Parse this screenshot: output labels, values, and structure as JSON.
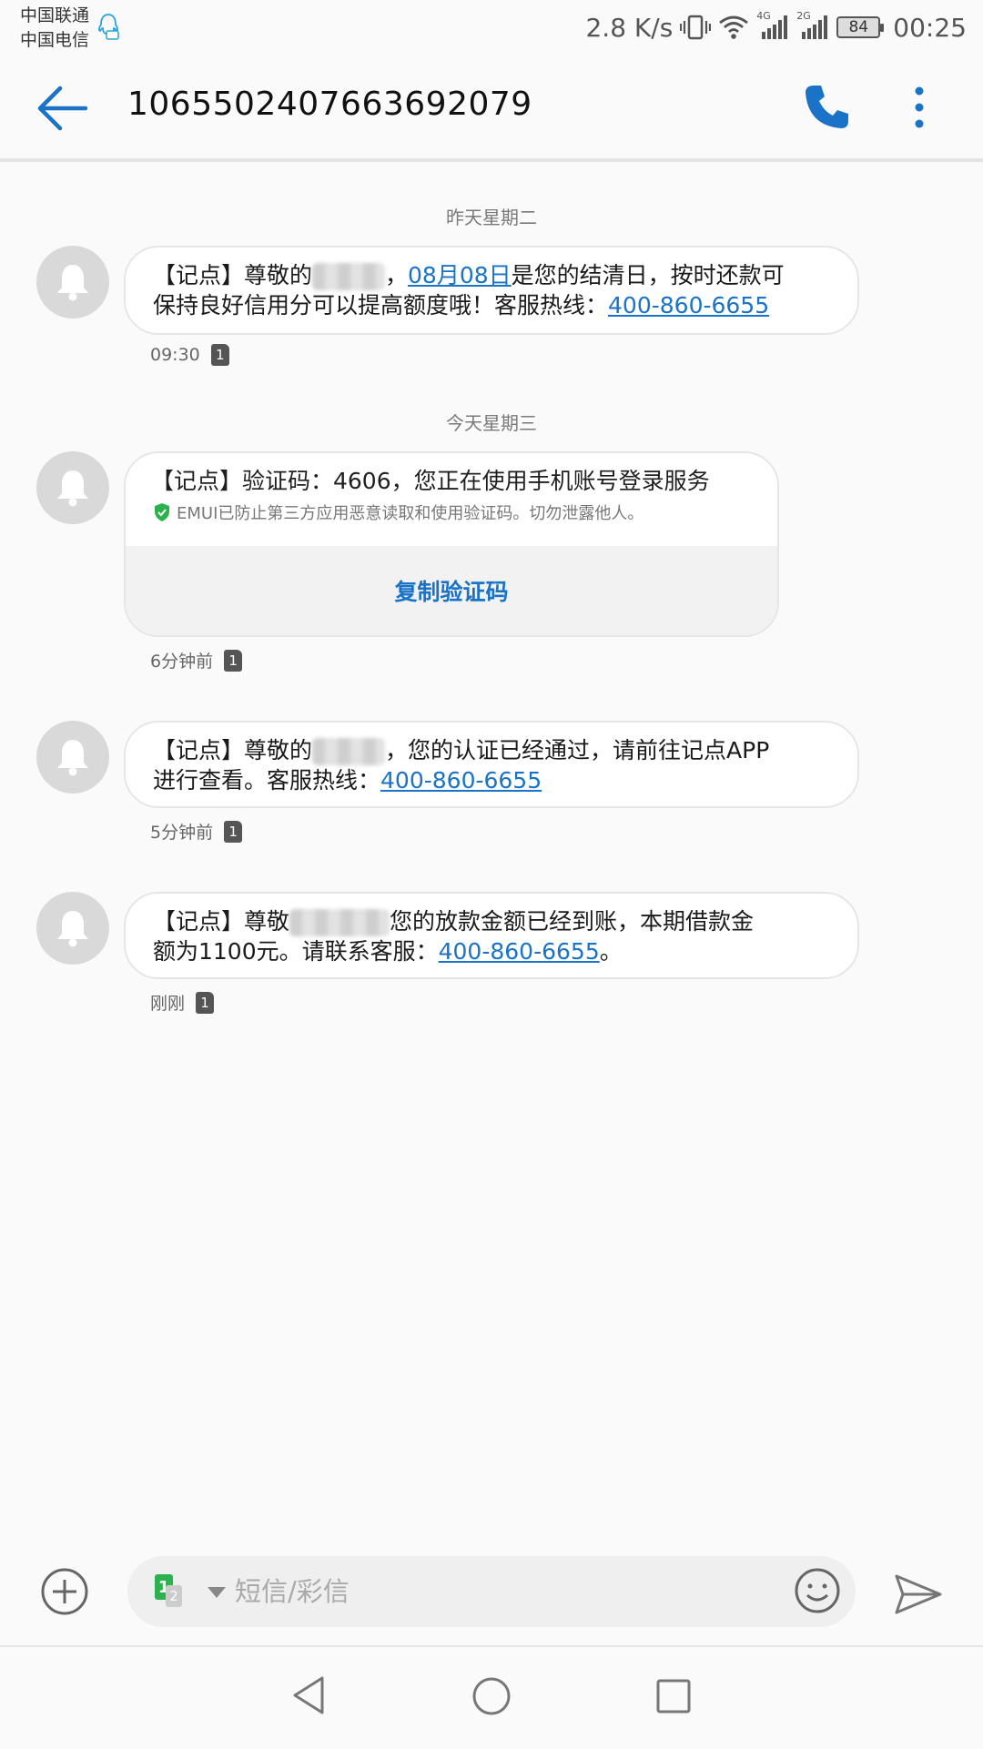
{
  "status": {
    "carrier1": "中国联通",
    "carrier2": "中国电信",
    "speed": "2.8 K/s",
    "net1": "4G",
    "net2": "2G",
    "battery": "84",
    "time": "00:25"
  },
  "header": {
    "title": "1065502407663692079"
  },
  "messages": {
    "m1": {
      "date": "昨天星期二",
      "prefix": "【记点】尊敬的",
      "sep": "，",
      "date_link": "08月08日",
      "body1": "是您的结清日，按时还款可",
      "body2": "保持良好信用分可以提高额度哦！客服热线：",
      "phone": "400-860-6655",
      "time": "09:30",
      "sim": "1"
    },
    "m2": {
      "date": "今天星期三",
      "text": "【记点】验证码：4606，您正在使用手机账号登录服务",
      "note": "EMUI已防止第三方应用恶意读取和使用验证码。切勿泄露他人。",
      "copy": "复制验证码",
      "time": "6分钟前",
      "sim": "1"
    },
    "m3": {
      "prefix": "【记点】尊敬的",
      "body1": "，您的认证已经通过，请前往记点APP",
      "body2": "进行查看。客服热线：",
      "phone": "400-860-6655",
      "time": "5分钟前",
      "sim": "1"
    },
    "m4": {
      "prefix": "【记点】尊敬",
      "body1": "您的放款金额已经到账，本期借款金",
      "body2": "额为1100元。请联系客服：",
      "phone": "400-860-6655",
      "end": "。",
      "time": "刚刚",
      "sim": "1"
    }
  },
  "composer": {
    "placeholder": "短信/彩信",
    "sim1": "1",
    "sim2": "2"
  },
  "colors": {
    "accent": "#1a73c7",
    "background": "#fafafa",
    "avatar": "#d9d9d9"
  }
}
